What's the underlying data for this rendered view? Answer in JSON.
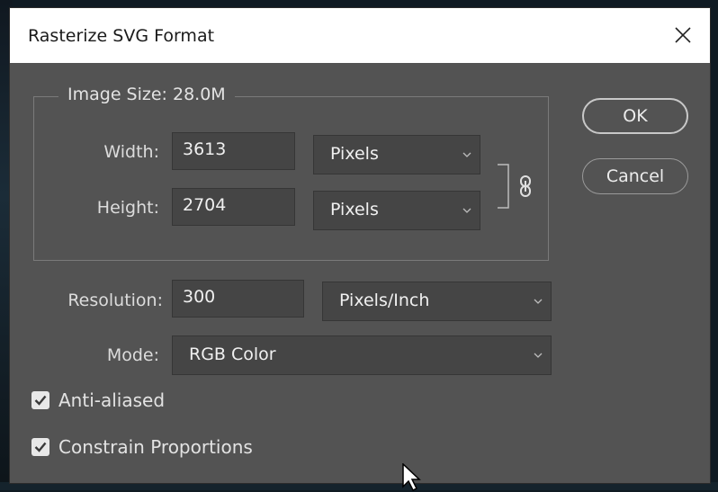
{
  "dialog": {
    "title": "Rasterize SVG Format"
  },
  "image_size": {
    "legend": "Image Size: 28.0M",
    "width_label": "Width:",
    "width_value": "3613",
    "width_unit": "Pixels",
    "height_label": "Height:",
    "height_value": "2704",
    "height_unit": "Pixels",
    "constrain_link_icon": "chain-link-icon"
  },
  "resolution": {
    "label": "Resolution:",
    "value": "300",
    "unit": "Pixels/Inch"
  },
  "mode": {
    "label": "Mode:",
    "value": "RGB Color"
  },
  "options": {
    "anti_aliased_label": "Anti-aliased",
    "anti_aliased_checked": true,
    "constrain_label": "Constrain Proportions",
    "constrain_checked": true
  },
  "buttons": {
    "ok": "OK",
    "cancel": "Cancel"
  },
  "colors": {
    "dialog_bg": "#535353",
    "field_bg": "#454545",
    "titlebar_bg": "#ffffff"
  }
}
